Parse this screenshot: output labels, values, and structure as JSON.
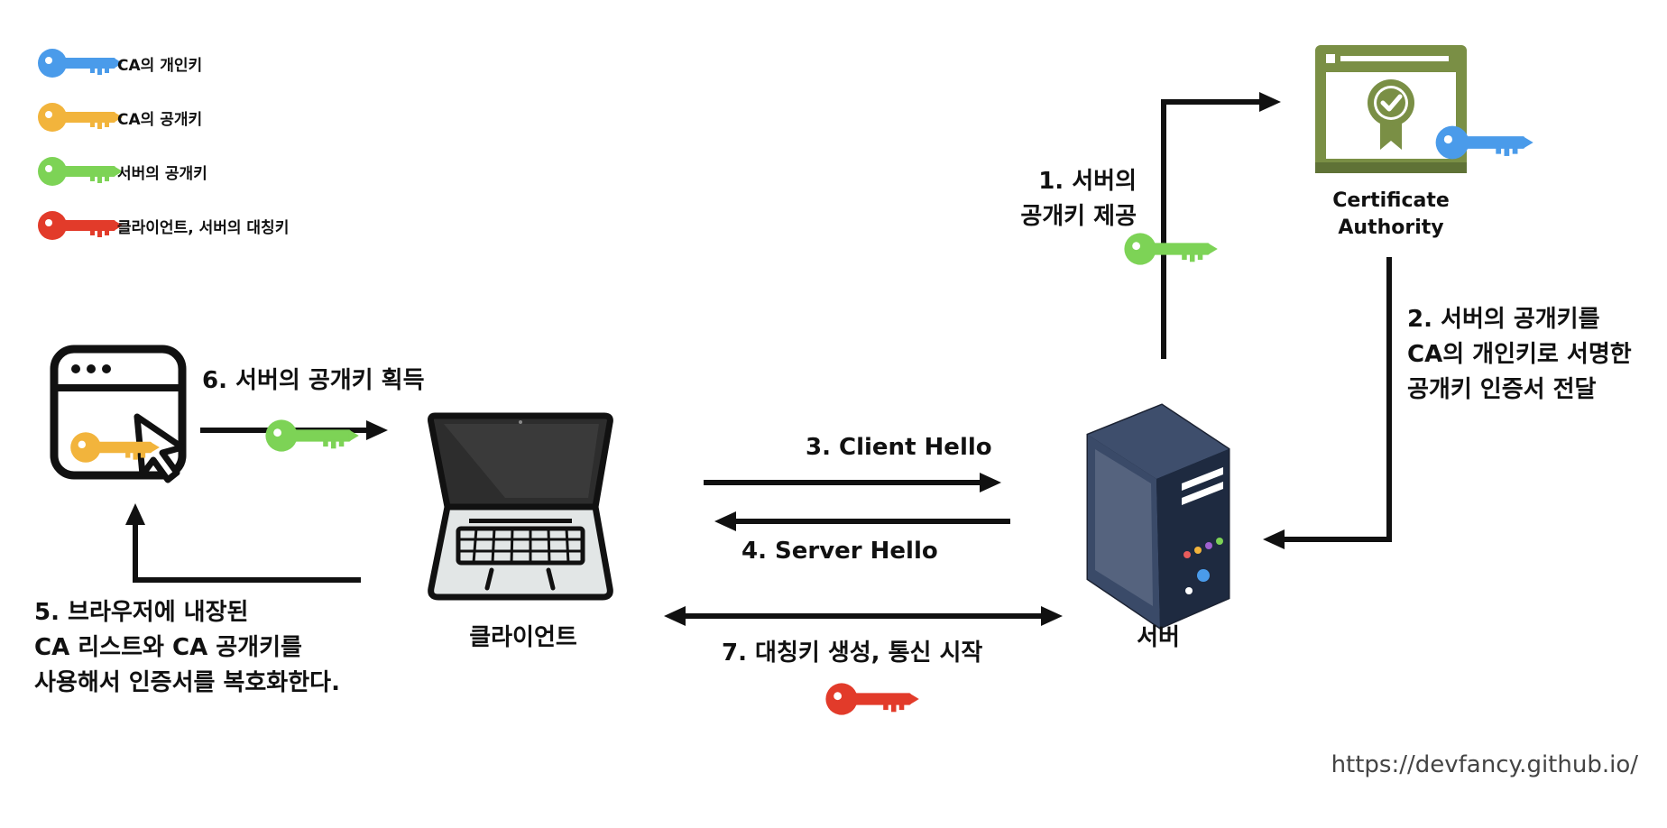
{
  "legend": [
    {
      "label": "CA의 개인키",
      "color": "#4A9BEA"
    },
    {
      "label": "CA의 공개키",
      "color": "#F2B43C"
    },
    {
      "label": "서버의 공개키",
      "color": "#7DD356"
    },
    {
      "label": "클라이언트, 서버의 대칭키",
      "color": "#E23B2A"
    }
  ],
  "nodes": {
    "ca": {
      "line1": "Certificate",
      "line2": "Authority",
      "color": "#7A8F45"
    },
    "server": {
      "label": "서버",
      "color": "#1E2A40"
    },
    "client": {
      "label": "클라이언트"
    }
  },
  "steps": {
    "s1": {
      "line1": "1. 서버의",
      "line2": "공개키 제공"
    },
    "s2": {
      "line1": "2. 서버의 공개키를",
      "line2": "CA의 개인키로 서명한",
      "line3": "공개키 인증서 전달"
    },
    "s3": {
      "text": "3. Client Hello"
    },
    "s4": {
      "text": "4. Server Hello"
    },
    "s5": {
      "line1": "5. 브라우저에 내장된",
      "line2": "CA 리스트와 CA 공개키를",
      "line3": "사용해서 인증서를 복호화한다."
    },
    "s6": {
      "text": "6. 서버의 공개키 획득"
    },
    "s7": {
      "text": "7. 대칭키 생성, 통신 시작"
    }
  },
  "footer": {
    "url": "https://devfancy.github.io/"
  }
}
